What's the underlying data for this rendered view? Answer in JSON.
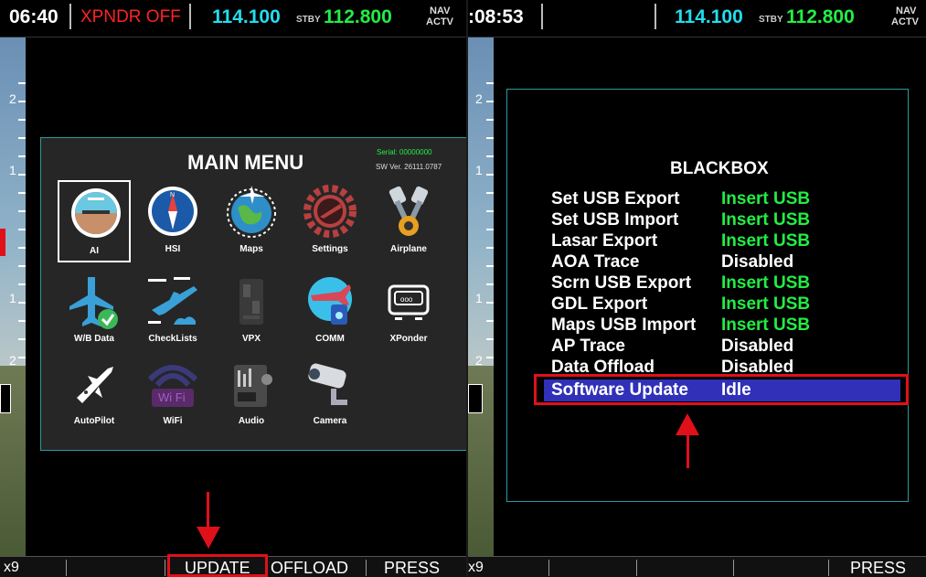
{
  "left": {
    "status": {
      "time": "06:40",
      "xpndr": "XPNDR OFF",
      "active_freq": "114.100",
      "stby_label": "STBY",
      "stby_freq": "112.800",
      "nav_label_top": "NAV",
      "nav_label_bottom": "ACTV"
    },
    "tape_marks": [
      "2",
      "1",
      "1",
      "2"
    ],
    "menu": {
      "title": "MAIN MENU",
      "serial": "Serial: 00000000",
      "version": "SW Ver. 26111.0787",
      "items": [
        {
          "label": "AI",
          "icon": "attitude-indicator-icon"
        },
        {
          "label": "HSI",
          "icon": "compass-icon"
        },
        {
          "label": "Maps",
          "icon": "globe-plane-icon"
        },
        {
          "label": "Settings",
          "icon": "gear-plane-icon"
        },
        {
          "label": "Airplane",
          "icon": "engine-pistons-icon"
        },
        {
          "label": "W/B Data",
          "icon": "plane-check-icon"
        },
        {
          "label": "CheckLists",
          "icon": "plane-takeoff-icon"
        },
        {
          "label": "VPX",
          "icon": "vpx-box-icon"
        },
        {
          "label": "COMM",
          "icon": "radio-plane-icon"
        },
        {
          "label": "XPonder",
          "icon": "transponder-icon"
        },
        {
          "label": "AutoPilot",
          "icon": "autopilot-plane-icon"
        },
        {
          "label": "WiFi",
          "icon": "wifi-icon",
          "badge": "Wi Fi"
        },
        {
          "label": "Audio",
          "icon": "audio-panel-icon"
        },
        {
          "label": "Camera",
          "icon": "security-camera-icon"
        }
      ]
    },
    "softkeys": {
      "left_cut": "x9",
      "update": "UPDATE",
      "offload": "OFFLOAD",
      "press": "PRESS"
    }
  },
  "right": {
    "status": {
      "time": ":08:53",
      "active_freq": "114.100",
      "stby_label": "STBY",
      "stby_freq": "112.800",
      "nav_label_top": "NAV",
      "nav_label_bottom": "ACTV"
    },
    "tape_marks": [
      "2",
      "1",
      "1",
      "2"
    ],
    "blackbox": {
      "title": "BLACKBOX",
      "rows": [
        {
          "key": "Set USB Export",
          "value": "Insert USB",
          "color": "#22ee44"
        },
        {
          "key": "Set USB Import",
          "value": "Insert USB",
          "color": "#22ee44"
        },
        {
          "key": "Lasar Export",
          "value": "Insert USB",
          "color": "#22ee44"
        },
        {
          "key": "AOA Trace",
          "value": "Disabled",
          "color": "#ffffff"
        },
        {
          "key": "Scrn USB Export",
          "value": "Insert USB",
          "color": "#22ee44"
        },
        {
          "key": "GDL Export",
          "value": "Insert USB",
          "color": "#22ee44"
        },
        {
          "key": "Maps USB Import",
          "value": "Insert USB",
          "color": "#22ee44"
        },
        {
          "key": "AP Trace",
          "value": "Disabled",
          "color": "#ffffff"
        },
        {
          "key": "Data Offload",
          "value": "Disabled",
          "color": "#ffffff"
        },
        {
          "key": "Software Update",
          "value": "Idle",
          "color": "#ffffff"
        }
      ]
    },
    "softkeys": {
      "left_cut": "x9",
      "press": "PRESS"
    }
  },
  "colors": {
    "cyan": "#22ddee",
    "green": "#22ee44",
    "red": "#ff2222",
    "highlight": "#3030b8",
    "annotation": "#e0101a"
  }
}
